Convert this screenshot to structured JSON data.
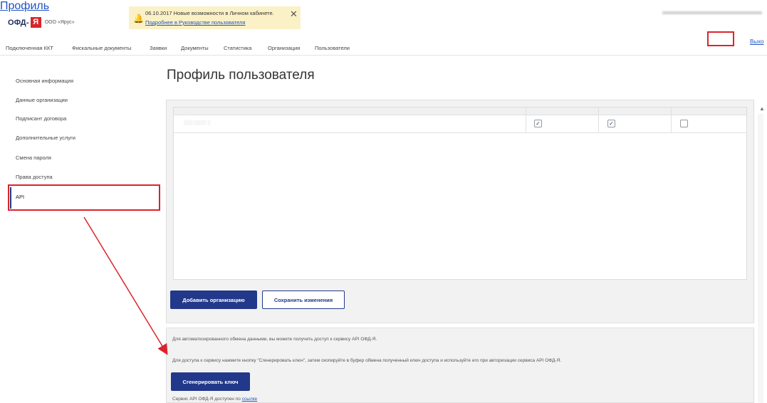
{
  "header": {
    "logo_text": "ОФД-",
    "logo_badge": "Я",
    "company": "ООО «Ярус»",
    "notice": {
      "date_text": "06.10.2017",
      "message": "Новые возможности в Личном кабинете.",
      "link": "Подробнее в Руководстве пользователя"
    },
    "profile_link": "Профиль",
    "exit_link": "Выхо"
  },
  "nav": {
    "items": [
      "Подключенная ККТ",
      "Фискальные документы",
      "Заявки",
      "Документы",
      "Статистика",
      "Организация",
      "Пользователи"
    ]
  },
  "sidebar": {
    "items": [
      "Основная информация",
      "Данные организации",
      "Подписант договора",
      "Дополнительные услуги",
      "Смена пароля",
      "Права доступа",
      "API"
    ]
  },
  "page": {
    "title": "Профиль пользователя"
  },
  "table": {
    "checkboxes": [
      true,
      true,
      false
    ]
  },
  "buttons": {
    "add_org": "Добавить организацию",
    "save": "Сохранить изменения",
    "generate_key": "Сгенерировать ключ"
  },
  "api_section": {
    "line1": "Для автоматизированного обмена данными, вы можете получить доступ к сервису API ОФД-Я.",
    "line2": "Для доступа к сервису нажмите кнопку \"Сгенерировать ключ\", затем скопируйте в буфер обмена полученный ключ доступа и используйте его при авторизации сервиса API ОФД-Я.",
    "line3_prefix": "Сервис API ОФД-Я доступен по",
    "line3_link": "ссылке"
  },
  "colors": {
    "accent": "#22388a",
    "highlight": "#d9252b",
    "notice_bg": "#fbf1c7"
  }
}
